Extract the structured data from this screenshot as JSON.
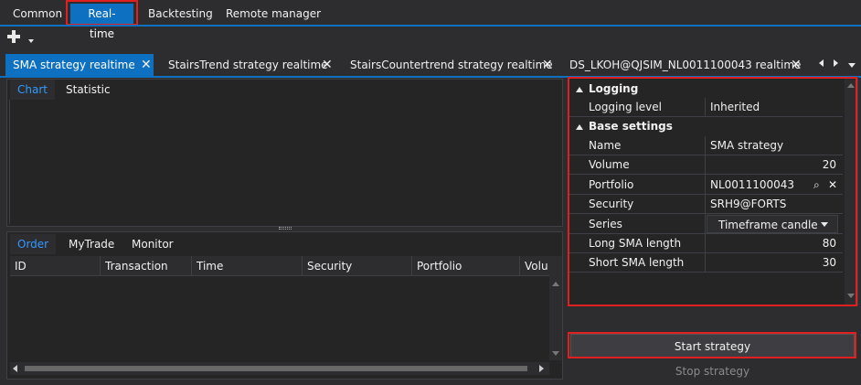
{
  "menu": {
    "items": [
      {
        "label": "Common",
        "active": false
      },
      {
        "label": "Real-time",
        "active": true
      },
      {
        "label": "Backtesting",
        "active": false
      },
      {
        "label": "Remote manager",
        "active": false
      }
    ]
  },
  "doc_tabs": [
    {
      "label": "SMA strategy realtime",
      "active": true
    },
    {
      "label": "StairsTrend strategy realtime",
      "active": false
    },
    {
      "label": "StairsCountertrend strategy realtime",
      "active": false
    },
    {
      "label": "DS_LKOH@QJSIM_NL0011100043 realtime",
      "active": false
    }
  ],
  "chart_panel": {
    "tabs": [
      {
        "label": "Chart",
        "active": true
      },
      {
        "label": "Statistic",
        "active": false
      }
    ]
  },
  "orders_panel": {
    "tabs": [
      {
        "label": "Order",
        "active": true
      },
      {
        "label": "MyTrade",
        "active": false
      },
      {
        "label": "Monitor",
        "active": false
      }
    ],
    "columns": [
      "ID",
      "Transaction",
      "Time",
      "Security",
      "Portfolio",
      "Volu"
    ]
  },
  "properties": {
    "logging": {
      "category": "Logging",
      "rows": [
        {
          "name": "Logging level",
          "value": "Inherited"
        }
      ]
    },
    "base": {
      "category": "Base settings",
      "rows": [
        {
          "name": "Name",
          "value": "SMA strategy"
        },
        {
          "name": "Volume",
          "value": "20"
        },
        {
          "name": "Portfolio",
          "value": "NL0011100043"
        },
        {
          "name": "Security",
          "value": "SRH9@FORTS"
        },
        {
          "name": "Series",
          "value": "Timeframe candle"
        },
        {
          "name": "Long SMA length",
          "value": "80"
        },
        {
          "name": "Short SMA length",
          "value": "30"
        }
      ]
    }
  },
  "buttons": {
    "start": "Start strategy",
    "stop": "Stop strategy"
  },
  "colors": {
    "accent": "#0e70c0",
    "highlight_box": "#e02020",
    "background": "#2d2d30",
    "panel": "#252526"
  }
}
